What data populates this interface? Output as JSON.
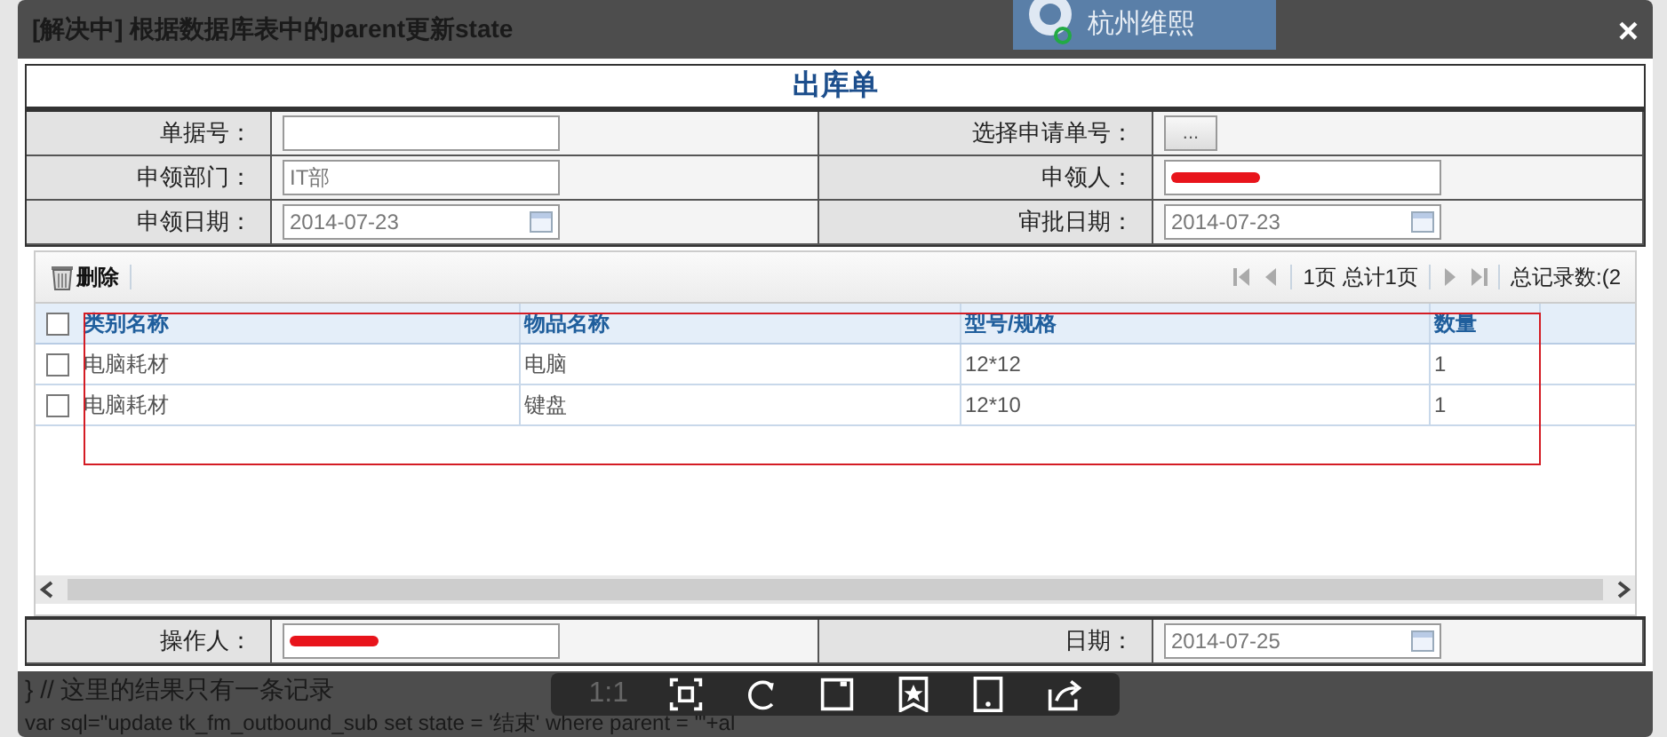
{
  "background_page": {
    "title": "[解决中] 根据数据库表中的parent更新state",
    "logo_text": "杭州维熙",
    "code_lines": [
      "} // 这里的结果只有一条记录",
      "var sql=\"update tk_fm_outbound_sub set  state = '结束' where parent = '\"+al"
    ]
  },
  "dialog": {
    "close": "×",
    "title": "出库单",
    "fields": [
      {
        "label": "单据号：",
        "kind": "text"
      },
      {
        "label": "选择申请单号：",
        "kind": "button",
        "value": "..."
      },
      {
        "label": "申领部门：",
        "kind": "text",
        "value": "IT部"
      },
      {
        "label": "申领人：",
        "kind": "redacted"
      },
      {
        "label": "申领日期：",
        "kind": "date",
        "value": "2014-07-23"
      },
      {
        "label": "审批日期：",
        "kind": "date",
        "value": "2014-07-23"
      }
    ],
    "toolbar": {
      "delete": "删除",
      "page_info": "1页 总计1页",
      "record_count": "总记录数:(2"
    },
    "table": {
      "all_checked": false,
      "columns": [
        "类别名称",
        "物品名称",
        "型号/规格",
        "数量"
      ],
      "rows": [
        {
          "checked": false,
          "cells": [
            "电脑耗材",
            "电脑",
            "12*12",
            "1"
          ]
        },
        {
          "checked": false,
          "cells": [
            "电脑耗材",
            "键盘",
            "12*10",
            "1"
          ]
        }
      ]
    },
    "footer_fields": [
      {
        "label": "操作人：",
        "kind": "redacted"
      },
      {
        "label": "日期：",
        "kind": "date",
        "value": "2014-07-25"
      }
    ]
  },
  "viewer_toolbar": {
    "zoom_label": "1:1"
  }
}
